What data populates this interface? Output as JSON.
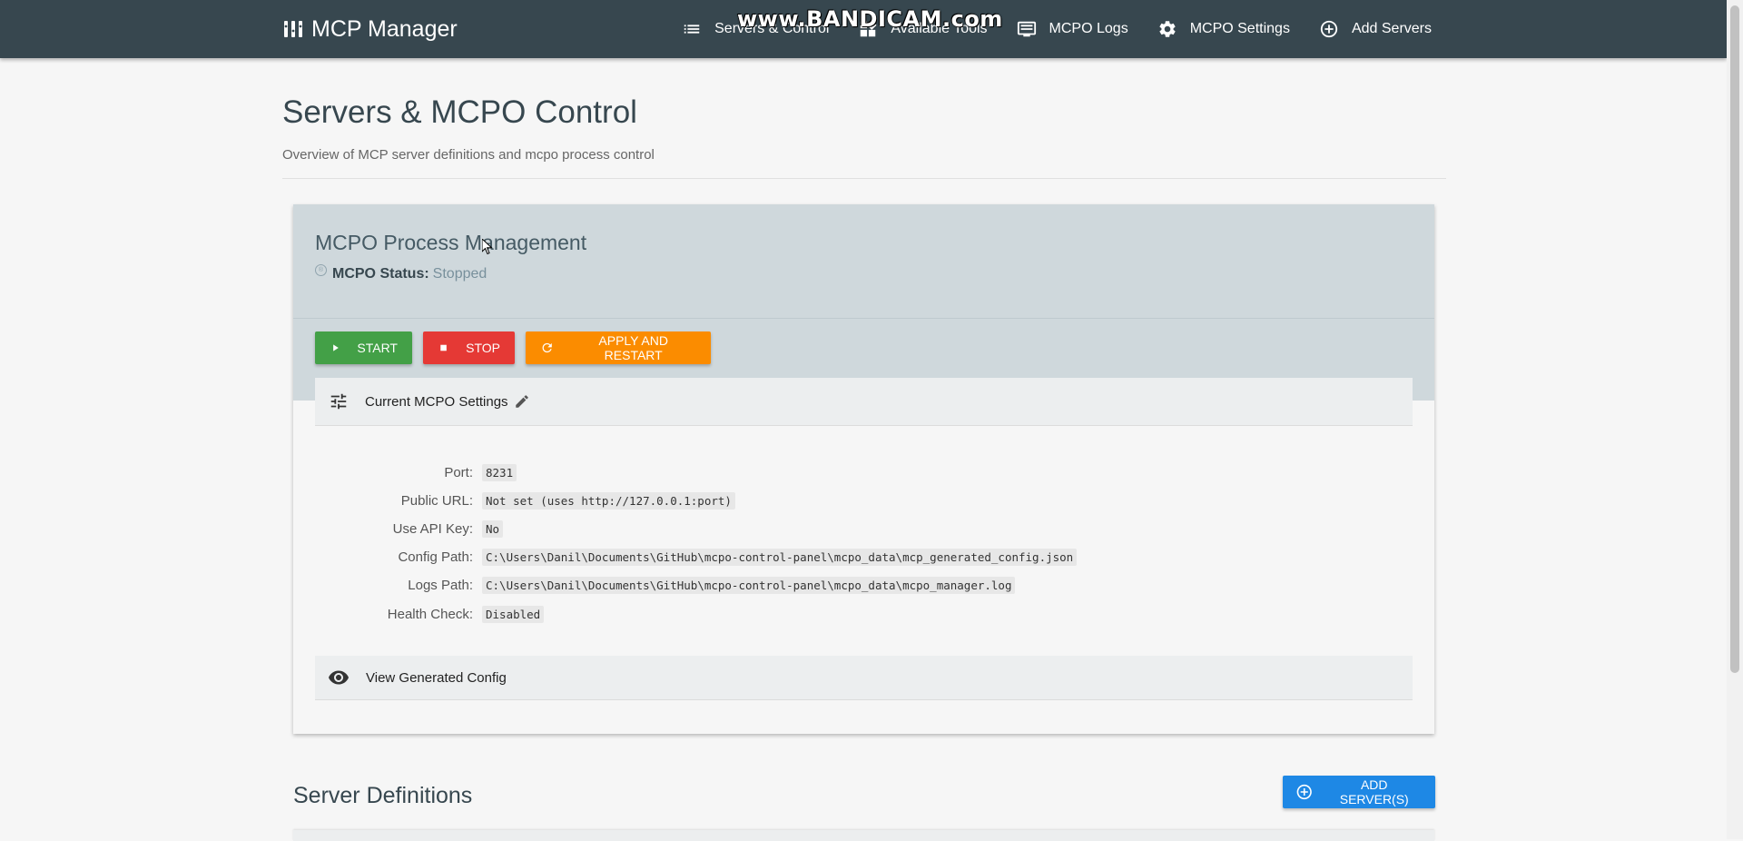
{
  "brand": {
    "title": "MCP Manager",
    "icon": "manager-icon"
  },
  "nav": {
    "items": [
      {
        "label": "Servers & Control",
        "icon": "list-icon"
      },
      {
        "label": "Available Tools",
        "icon": "widgets-icon"
      },
      {
        "label": "MCPO Logs",
        "icon": "logs-icon"
      },
      {
        "label": "MCPO Settings",
        "icon": "gear-icon"
      },
      {
        "label": "Add Servers",
        "icon": "add-circle-icon"
      }
    ]
  },
  "watermark": "www.BANDICAM.com",
  "header": {
    "title": "Servers & MCPO Control",
    "subtitle": "Overview of MCP server definitions and mcpo process control"
  },
  "process": {
    "title": "MCPO Process Management",
    "status_label": "MCPO Status:",
    "status_value": "Stopped",
    "buttons": {
      "start": "Start",
      "stop": "Stop",
      "restart": "Apply and Restart"
    },
    "colors": {
      "start": "#43a047",
      "stop": "#e53935",
      "restart": "#fb8c00"
    }
  },
  "settings": {
    "title": "Current MCPO Settings",
    "rows": [
      {
        "label": "Port:",
        "value": "8231"
      },
      {
        "label": "Public URL:",
        "value": "Not set (uses http://127.0.0.1:port)"
      },
      {
        "label": "Use API Key:",
        "value": "No"
      },
      {
        "label": "Config Path:",
        "value": "C:\\Users\\Danil\\Documents\\GitHub\\mcpo-control-panel\\mcpo_data\\mcp_generated_config.json"
      },
      {
        "label": "Logs Path:",
        "value": "C:\\Users\\Danil\\Documents\\GitHub\\mcpo-control-panel\\mcpo_data\\mcpo_manager.log"
      },
      {
        "label": "Health Check:",
        "value": "Disabled"
      }
    ]
  },
  "config": {
    "title": "View Generated Config"
  },
  "server_definitions": {
    "title": "Server Definitions",
    "add_button": "Add Server(s)",
    "accent": "#1e88e5"
  }
}
